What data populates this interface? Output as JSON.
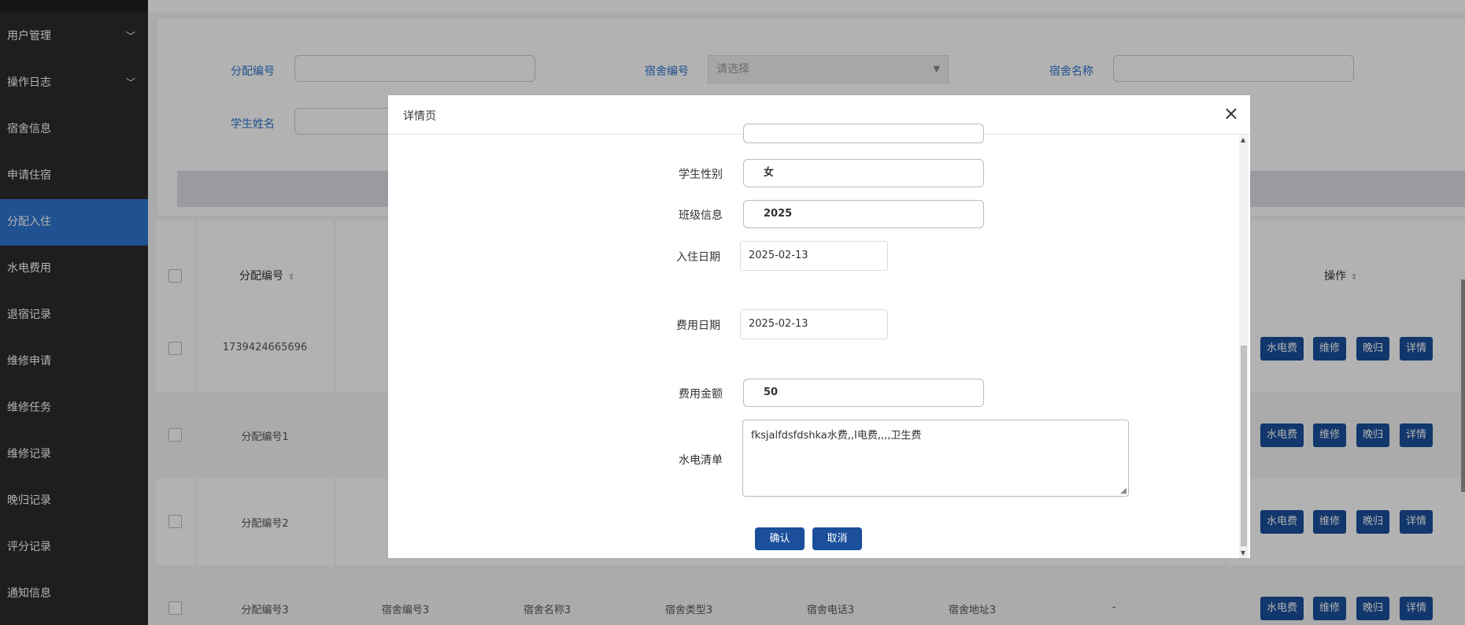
{
  "sidebar": {
    "items": [
      {
        "label": "用户管理",
        "chevron": true
      },
      {
        "label": "操作日志",
        "chevron": true
      },
      {
        "label": "宿舍信息"
      },
      {
        "label": "申请住宿"
      },
      {
        "label": "分配入住",
        "active": true
      },
      {
        "label": "水电费用"
      },
      {
        "label": "退宿记录"
      },
      {
        "label": "维修申请"
      },
      {
        "label": "维修任务"
      },
      {
        "label": "维修记录"
      },
      {
        "label": "晚归记录"
      },
      {
        "label": "评分记录"
      },
      {
        "label": "通知信息"
      }
    ],
    "chevron_icon": "chevron-down-icon"
  },
  "search": {
    "fp_label": "分配编号",
    "dorm_no_label": "宿舍编号",
    "dorm_no_placeholder": "请选择",
    "dorm_name_label": "宿舍名称",
    "student_name_label": "学生姓名"
  },
  "table": {
    "headers": {
      "fp": "分配编号",
      "op": "操作"
    },
    "rows": [
      {
        "fp": "1739424665696"
      },
      {
        "fp": "分配编号1"
      },
      {
        "fp": "分配编号2"
      },
      {
        "fp": "分配编号3",
        "dorm_no": "宿舍编号3",
        "dorm_name": "宿舍名称3",
        "dorm_type": "宿舍类型3",
        "dorm_phone": "宿舍电话3",
        "dorm_addr": "宿舍地址3",
        "other": "-"
      }
    ],
    "actions": [
      "水电费",
      "维修",
      "晚归",
      "详情"
    ]
  },
  "modal": {
    "title": "详情页",
    "close": "×",
    "fields": {
      "gender_label": "学生性别",
      "gender_value": "女",
      "class_label": "班级信息",
      "class_value": "2025",
      "checkin_label": "入住日期",
      "checkin_value": "2025-02-13",
      "fee_date_label": "费用日期",
      "fee_date_value": "2025-02-13",
      "amount_label": "费用金额",
      "amount_value": "50",
      "list_label": "水电清单",
      "list_value": "fksjalfdsfdshka水费,,I电费,,,,卫生费"
    },
    "confirm": "确认",
    "cancel": "取消"
  },
  "colors": {
    "sidebar_bg": "#2b2b2b",
    "active": "#2f74d0",
    "action_btn": "#1b4f9c"
  }
}
